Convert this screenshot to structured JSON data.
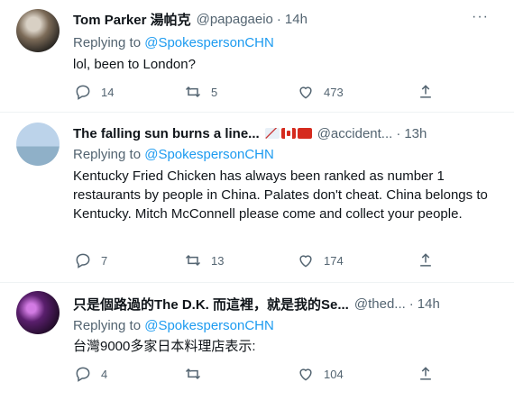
{
  "tweets": [
    {
      "name": "Tom Parker 湯帕克",
      "handle": "@papagaeio",
      "time": "14h",
      "reply_prefix": "Replying to",
      "reply_to": "@SpokespersonCHN",
      "text": "lol, been to London?",
      "replies": "14",
      "retweets": "5",
      "likes": "473"
    },
    {
      "name": "The falling sun burns a line...",
      "handle": "@accident...",
      "time": "13h",
      "reply_prefix": "Replying to",
      "reply_to": "@SpokespersonCHN",
      "text": "Kentucky Fried Chicken has always been ranked as number 1 restaurants by people in China. Palates don't cheat. China belongs to Kentucky. Mitch McConnell please come and collect your people.",
      "replies": "7",
      "retweets": "13",
      "likes": "174"
    },
    {
      "name": "只是個路過的The D.K. 而這裡，就是我的Se...",
      "handle": "@thed...",
      "time": "14h",
      "reply_prefix": "Replying to",
      "reply_to": "@SpokespersonCHN",
      "text": "台灣9000多家日本料理店表示:",
      "replies": "4",
      "retweets": "",
      "likes": "104"
    }
  ],
  "ui": {
    "dot": "·",
    "more": "···"
  },
  "colors": {
    "accent": "#1d9bf0",
    "secondary_text": "#536471",
    "separator": "#eff3f4"
  },
  "icons": [
    "reply-icon",
    "retweet-icon",
    "like-icon",
    "share-icon",
    "more-icon"
  ]
}
